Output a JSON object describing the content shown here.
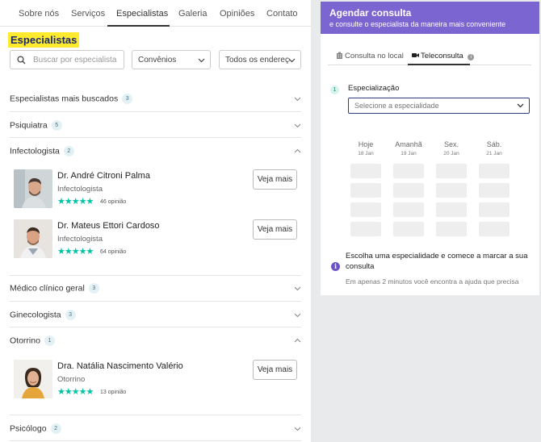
{
  "tabs": [
    "Sobre nós",
    "Serviços",
    "Especialistas",
    "Galeria",
    "Opiniões",
    "Contato"
  ],
  "section_title": "Especialistas",
  "search": {
    "placeholder": "Buscar por especialista"
  },
  "filters": {
    "convenios": "Convênios",
    "enderecos": "Todos os endereços"
  },
  "categories": [
    {
      "label": "Especialistas mais buscados",
      "count": "3",
      "expanded": false
    },
    {
      "label": "Psiquiatra",
      "count": "5",
      "expanded": false
    },
    {
      "label": "Infectologista",
      "count": "2",
      "expanded": true
    },
    {
      "label": "Médico clínico geral",
      "count": "3",
      "expanded": false
    },
    {
      "label": "Ginecologista",
      "count": "3",
      "expanded": false
    },
    {
      "label": "Otorrino",
      "count": "1",
      "expanded": true
    },
    {
      "label": "Psicólogo",
      "count": "2",
      "expanded": false
    }
  ],
  "doctors": [
    {
      "name": "Dr. André Citroni Palma",
      "specialty": "Infectologista",
      "stars": "★★★★★",
      "rating": 5,
      "reviews": "46 opinião",
      "button": "Veja mais"
    },
    {
      "name": "Dr. Mateus Ettori Cardoso",
      "specialty": "Infectologista",
      "stars": "★★★★★",
      "rating": 5,
      "reviews": "64 opinião",
      "button": "Veja mais"
    },
    {
      "name": "Dra. Natália Nascimento Valério",
      "specialty": "Otorrino",
      "stars": "★★★★★",
      "rating": 5,
      "reviews": "13 opinião",
      "button": "Veja mais"
    }
  ],
  "booking": {
    "title": "Agendar consulta",
    "subtitle": "e consulte o especialista da maneira mais conveniente",
    "tabs": {
      "presencial": "Consulta no local",
      "online": "Teleconsulta"
    },
    "step": "1",
    "spec_label": "Especialização",
    "spec_placeholder": "Selecione a especialidade",
    "days": [
      {
        "name": "Hoje",
        "date": "18 Jan"
      },
      {
        "name": "Amanhã",
        "date": "19 Jan"
      },
      {
        "name": "Sex.",
        "date": "20 Jan"
      },
      {
        "name": "Sáb.",
        "date": "21 Jan"
      }
    ],
    "info_title": "Escolha uma especialidade e comece a marcar a sua consulta",
    "info_sub": "Em apenas 2 minutos você encontra a ajuda que precisa"
  },
  "colors": {
    "accent": "#7b65d0",
    "stars": "#00c3a5",
    "highlight": "#ffea2e"
  }
}
